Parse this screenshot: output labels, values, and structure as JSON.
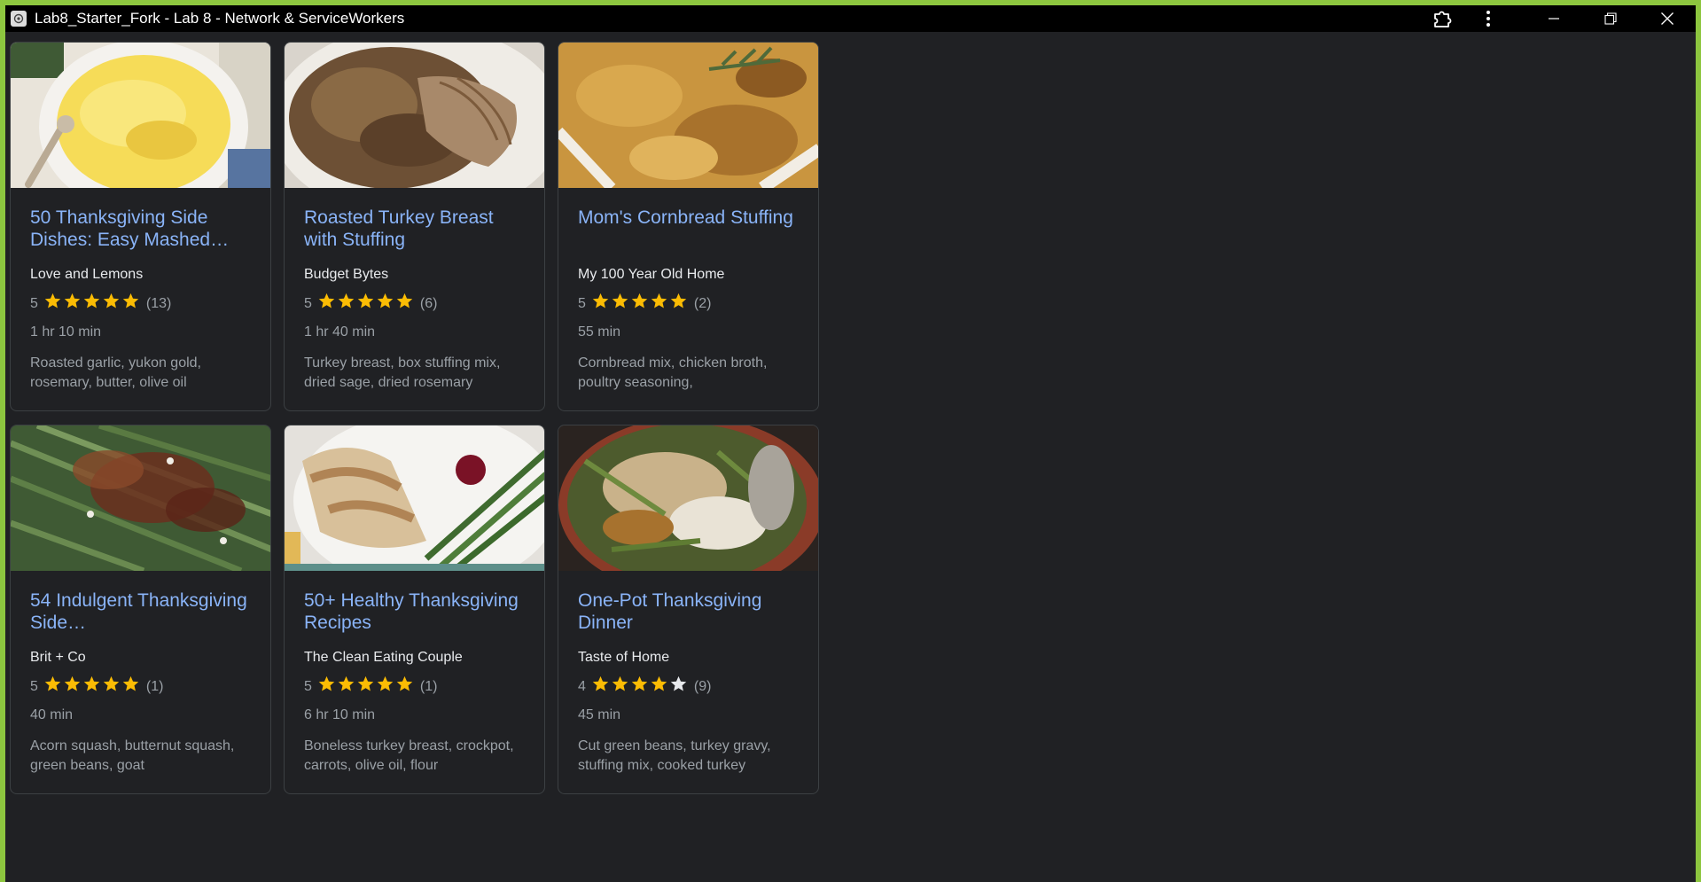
{
  "window": {
    "title": "Lab8_Starter_Fork - Lab 8 - Network & ServiceWorkers",
    "accent": "#8dc63f",
    "titlebar_bg": "#000000"
  },
  "icons": {
    "app": "app-icon",
    "extensions": "puzzle-icon",
    "menu": "kebab-menu-icon",
    "minimize": "minimize-icon",
    "restore": "restore-icon",
    "close": "close-icon",
    "star": "star-icon"
  },
  "colors": {
    "link": "#8ab4f8",
    "star_filled": "#fbbc04",
    "star_empty": "#e8eaed",
    "background": "#202124"
  },
  "cards": [
    {
      "title": "50 Thanksgiving Side Dishes: Easy Mashed…",
      "org": "Love and Lemons",
      "rating": "5",
      "stars": 5,
      "reviews": "(13)",
      "time": "1 hr 10 min",
      "ingredients": "Roasted garlic, yukon gold, rosemary, butter, olive oil",
      "image": "mashed potatoes in white bowl"
    },
    {
      "title": "Roasted Turkey Breast with Stuffing",
      "org": "Budget Bytes",
      "rating": "5",
      "stars": 5,
      "reviews": "(6)",
      "time": "1 hr 40 min",
      "ingredients": "Turkey breast, box stuffing mix, dried sage, dried rosemary",
      "image": "sliced turkey breast over stuffing"
    },
    {
      "title": "Mom's Cornbread Stuffing",
      "org": "My 100 Year Old Home",
      "rating": "5",
      "stars": 5,
      "reviews": "(2)",
      "time": "55 min",
      "ingredients": "Cornbread mix, chicken broth, poultry seasoning,",
      "image": "cornbread stuffing with rosemary"
    },
    {
      "title": "54 Indulgent Thanksgiving Side…",
      "org": "Brit + Co",
      "rating": "5",
      "stars": 5,
      "reviews": "(1)",
      "time": "40 min",
      "ingredients": "Acorn squash, butternut squash, green beans, goat",
      "image": "green beans with pecans and cranberries"
    },
    {
      "title": "50+ Healthy Thanksgiving Recipes",
      "org": "The Clean Eating Couple",
      "rating": "5",
      "stars": 5,
      "reviews": "(1)",
      "time": "6 hr 10 min",
      "ingredients": "Boneless turkey breast, crockpot, carrots, olive oil, flour",
      "image": "turkey slices with gravy and green beans"
    },
    {
      "title": "One-Pot Thanksgiving Dinner",
      "org": "Taste of Home",
      "rating": "4",
      "stars": 4,
      "reviews": "(9)",
      "time": "45 min",
      "ingredients": "Cut green beans, turkey gravy, stuffing mix, cooked turkey",
      "image": "skillet with turkey, stuffing and green beans"
    }
  ]
}
